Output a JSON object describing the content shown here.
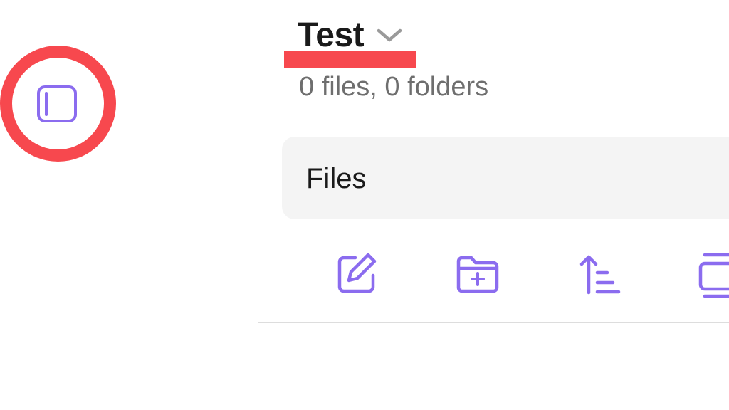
{
  "header": {
    "vault_title": "Test",
    "vault_stats": "0 files, 0 folders"
  },
  "files_box": {
    "label": "Files"
  },
  "icons": {
    "sidebar_toggle": "sidebar-toggle-icon",
    "vault_switcher": "chevron-down-icon",
    "new_note": "new-note-icon",
    "new_folder": "new-folder-icon",
    "sort": "sort-icon",
    "collapse": "collapse-all-icon"
  },
  "colors": {
    "accent": "#8b6cef",
    "annotation": "#f7484e",
    "title_text": "#1a1a1a",
    "muted_text": "#6e6e6e",
    "files_box_bg": "#f4f4f4"
  }
}
